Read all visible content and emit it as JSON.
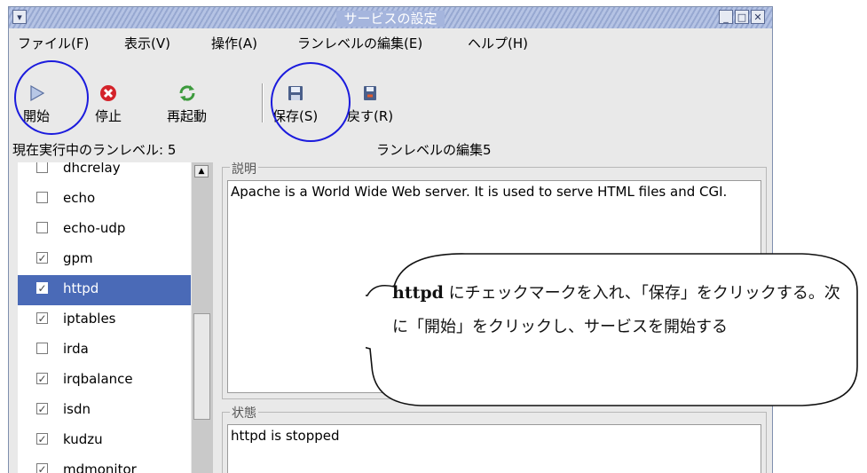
{
  "window": {
    "title": "サービスの設定"
  },
  "menu": [
    {
      "label": "ファイル(F)"
    },
    {
      "label": "表示(V)"
    },
    {
      "label": "操作(A)"
    },
    {
      "label": "ランレベルの編集(E)"
    },
    {
      "label": "ヘルプ(H)"
    }
  ],
  "toolbar": {
    "start": "開始",
    "stop": "停止",
    "restart": "再起動",
    "save": "保存(S)",
    "revert": "戻す(R)"
  },
  "status": {
    "current_runlevel": "現在実行中のランレベル: 5",
    "editing_runlevel": "ランレベルの編集5"
  },
  "services": [
    {
      "name": "dhcrelay",
      "checked": false
    },
    {
      "name": "echo",
      "checked": false
    },
    {
      "name": "echo-udp",
      "checked": false
    },
    {
      "name": "gpm",
      "checked": true
    },
    {
      "name": "httpd",
      "checked": true,
      "selected": true
    },
    {
      "name": "iptables",
      "checked": true
    },
    {
      "name": "irda",
      "checked": false
    },
    {
      "name": "irqbalance",
      "checked": true
    },
    {
      "name": "isdn",
      "checked": true
    },
    {
      "name": "kudzu",
      "checked": true
    },
    {
      "name": "mdmonitor",
      "checked": true
    }
  ],
  "description": {
    "label": "説明",
    "text": "Apache is a World Wide Web server.  It is used to serve HTML files and CGI."
  },
  "state": {
    "label": "状態",
    "text": "httpd is stopped"
  },
  "callout": {
    "bold": "httpd",
    "text": " にチェックマークを入れ、「保存」をクリックする。次に「開始」をクリックし、サービスを開始する"
  },
  "colors": {
    "selection": "#4a6ab7",
    "annotation_circle": "#1b1bdd"
  }
}
